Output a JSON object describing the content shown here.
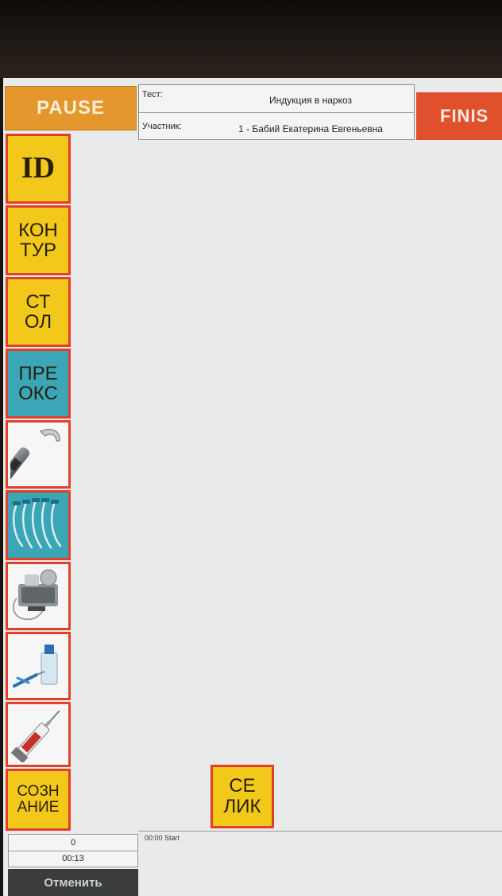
{
  "header": {
    "pause_label": "PAUSE",
    "finish_label": "FINIS",
    "test_label": "Тест:",
    "test_value": "Индукция в наркоз",
    "participant_label": "Участник:",
    "participant_value": "1 - Бабий Екатерина Евгеньевна"
  },
  "sidebar": {
    "items": [
      {
        "label": "ID",
        "color": "yellow"
      },
      {
        "label": "КОН\nТУР",
        "color": "yellow"
      },
      {
        "label": "СТ\nОЛ",
        "color": "yellow"
      },
      {
        "label": "ПРЕ\nОКС",
        "color": "teal"
      },
      {
        "icon": "laryngoscope-icon"
      },
      {
        "icon": "endotracheal-tubes-icon"
      },
      {
        "icon": "suction-device-icon"
      },
      {
        "icon": "iv-catheter-vial-icon"
      },
      {
        "icon": "syringe-icon"
      },
      {
        "label": "СОЗН\nАНИЕ",
        "color": "yellow"
      }
    ]
  },
  "main": {
    "selik_label": "СЕ\nЛИК"
  },
  "footer": {
    "counter": "0",
    "timer": "00:13",
    "cancel_label": "Отменить",
    "log_entry": "00:00  Start"
  },
  "colors": {
    "accent_yellow": "#f2c81a",
    "accent_teal": "#3aa6b6",
    "border_red": "#e0402c",
    "pause_orange": "#e3972c",
    "finish_red": "#e1502c"
  }
}
